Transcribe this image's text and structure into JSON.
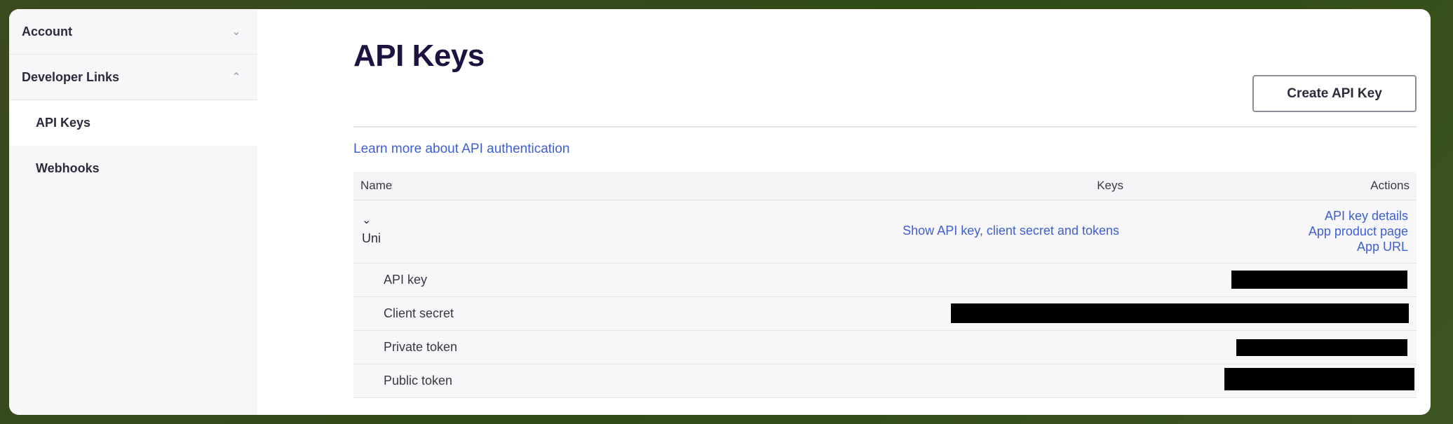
{
  "sidebar": {
    "sections": [
      {
        "label": "Account",
        "expanded": false
      },
      {
        "label": "Developer Links",
        "expanded": true
      }
    ],
    "items": [
      {
        "label": "API Keys",
        "active": true
      },
      {
        "label": "Webhooks",
        "active": false
      }
    ]
  },
  "page": {
    "title": "API Keys",
    "create_button": "Create API Key",
    "learn_link": "Learn more about API authentication"
  },
  "table": {
    "headers": {
      "name": "Name",
      "keys": "Keys",
      "actions": "Actions"
    },
    "app": {
      "name": "Uni",
      "show_link": "Show API key, client secret and tokens",
      "actions": [
        "API key details",
        "App product page",
        "App URL"
      ]
    },
    "key_rows": [
      {
        "label": "API key",
        "value": "redacted"
      },
      {
        "label": "Client secret",
        "value": "redacted"
      },
      {
        "label": "Private token",
        "value": "redacted"
      },
      {
        "label": "Public token",
        "value": "redacted"
      }
    ]
  },
  "colors": {
    "accent_link": "#3e5fd4",
    "title": "#1d1240",
    "redaction": "#000000"
  },
  "icons": {
    "collapsed": "chevron-down-icon",
    "expanded": "chevron-up-icon",
    "row_expand": "chevron-down-icon"
  }
}
